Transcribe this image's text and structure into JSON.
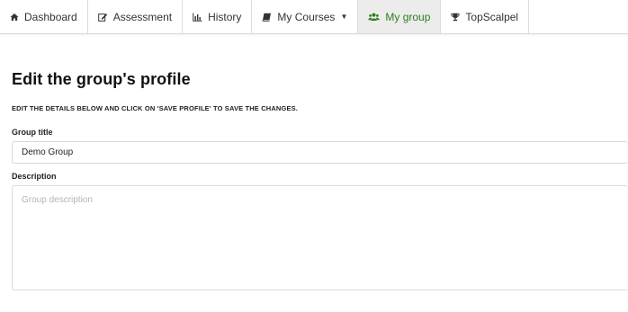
{
  "nav": {
    "items": [
      {
        "label": "Dashboard",
        "icon": "home-icon"
      },
      {
        "label": "Assessment",
        "icon": "edit-icon"
      },
      {
        "label": "History",
        "icon": "bar-chart-icon"
      },
      {
        "label": "My Courses",
        "icon": "book-icon"
      },
      {
        "label": "My group",
        "icon": "group-icon"
      },
      {
        "label": "TopScalpel",
        "icon": "trophy-icon"
      }
    ],
    "active": "My group",
    "active_color": "#2e7d1f"
  },
  "page": {
    "title": "Edit the group's profile",
    "instructions": "EDIT THE DETAILS BELOW AND CLICK ON 'SAVE PROFILE' TO SAVE THE CHANGES."
  },
  "form": {
    "title_label": "Group title",
    "title_value": "Demo Group",
    "description_label": "Description",
    "description_placeholder": "Group description"
  }
}
